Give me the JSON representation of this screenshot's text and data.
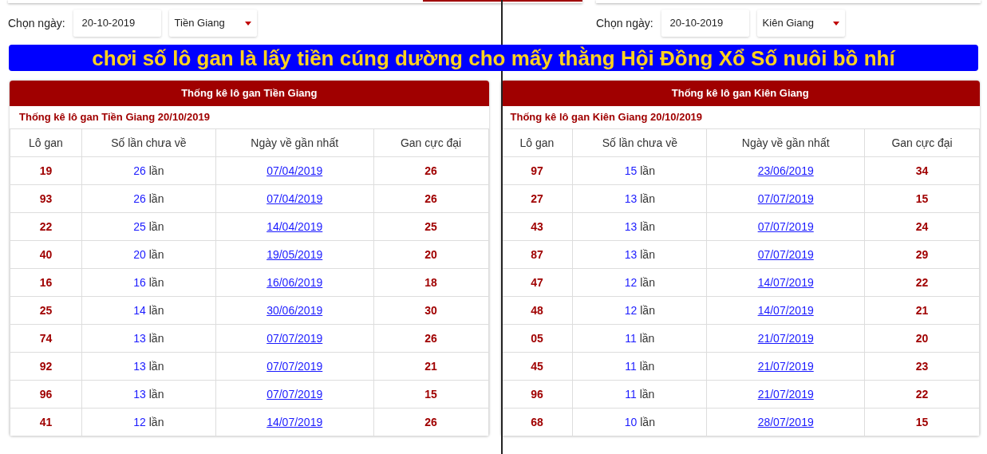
{
  "banner": "chơi số lô gan là lấy tiền cúng dường cho mấy thằng Hội Đồng Xổ Số nuôi bồ nhí",
  "panels": [
    {
      "date_label": "Chọn ngày:",
      "date": "20-10-2019",
      "province": "Tiền Giang",
      "title": "Thống kê lô gan Tiền Giang",
      "subtitle": "Thống kê lô gan Tiền Giang 20/10/2019",
      "columns": [
        "Lô gan",
        "Số lần chưa về",
        "Ngày về gần nhất",
        "Gan cực đại"
      ],
      "rows": [
        {
          "number": "19",
          "misses": "26",
          "unit": "lần",
          "last_date": "07/04/2019",
          "max_gap": "26"
        },
        {
          "number": "93",
          "misses": "26",
          "unit": "lần",
          "last_date": "07/04/2019",
          "max_gap": "26"
        },
        {
          "number": "22",
          "misses": "25",
          "unit": "lần",
          "last_date": "14/04/2019",
          "max_gap": "25"
        },
        {
          "number": "40",
          "misses": "20",
          "unit": "lần",
          "last_date": "19/05/2019",
          "max_gap": "20"
        },
        {
          "number": "16",
          "misses": "16",
          "unit": "lần",
          "last_date": "16/06/2019",
          "max_gap": "18"
        },
        {
          "number": "25",
          "misses": "14",
          "unit": "lần",
          "last_date": "30/06/2019",
          "max_gap": "30"
        },
        {
          "number": "74",
          "misses": "13",
          "unit": "lần",
          "last_date": "07/07/2019",
          "max_gap": "26"
        },
        {
          "number": "92",
          "misses": "13",
          "unit": "lần",
          "last_date": "07/07/2019",
          "max_gap": "21"
        },
        {
          "number": "96",
          "misses": "13",
          "unit": "lần",
          "last_date": "07/07/2019",
          "max_gap": "15"
        },
        {
          "number": "41",
          "misses": "12",
          "unit": "lần",
          "last_date": "14/07/2019",
          "max_gap": "26"
        }
      ]
    },
    {
      "date_label": "Chọn ngày:",
      "date": "20-10-2019",
      "province": "Kiên Giang",
      "title": "Thống kê lô gan Kiên Giang",
      "subtitle": "Thống kê lô gan Kiên Giang 20/10/2019",
      "columns": [
        "Lô gan",
        "Số lần chưa về",
        "Ngày về gần nhất",
        "Gan cực đại"
      ],
      "rows": [
        {
          "number": "97",
          "misses": "15",
          "unit": "lần",
          "last_date": "23/06/2019",
          "max_gap": "34"
        },
        {
          "number": "27",
          "misses": "13",
          "unit": "lần",
          "last_date": "07/07/2019",
          "max_gap": "15"
        },
        {
          "number": "43",
          "misses": "13",
          "unit": "lần",
          "last_date": "07/07/2019",
          "max_gap": "24"
        },
        {
          "number": "87",
          "misses": "13",
          "unit": "lần",
          "last_date": "07/07/2019",
          "max_gap": "29"
        },
        {
          "number": "47",
          "misses": "12",
          "unit": "lần",
          "last_date": "14/07/2019",
          "max_gap": "22"
        },
        {
          "number": "48",
          "misses": "12",
          "unit": "lần",
          "last_date": "14/07/2019",
          "max_gap": "21"
        },
        {
          "number": "05",
          "misses": "11",
          "unit": "lần",
          "last_date": "21/07/2019",
          "max_gap": "20"
        },
        {
          "number": "45",
          "misses": "11",
          "unit": "lần",
          "last_date": "21/07/2019",
          "max_gap": "23"
        },
        {
          "number": "96",
          "misses": "11",
          "unit": "lần",
          "last_date": "21/07/2019",
          "max_gap": "22"
        },
        {
          "number": "68",
          "misses": "10",
          "unit": "lần",
          "last_date": "28/07/2019",
          "max_gap": "15"
        }
      ]
    }
  ]
}
